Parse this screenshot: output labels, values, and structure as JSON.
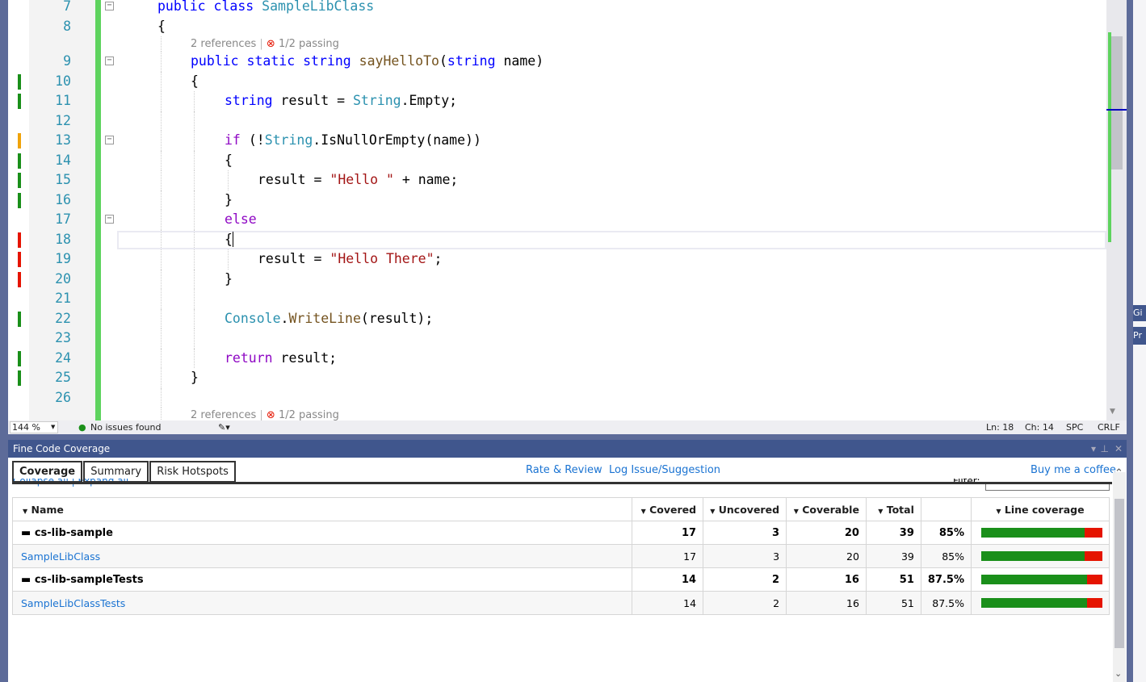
{
  "editor": {
    "colors": {
      "covered": "#1a8f1a",
      "partial": "#f0a30a",
      "uncovered": "#e51400"
    },
    "rows": [
      {
        "n": "7",
        "indent": 1,
        "fold": true,
        "tokens": [
          [
            "k",
            "public "
          ],
          [
            "k",
            "class "
          ],
          [
            "t",
            "SampleLibClass"
          ]
        ]
      },
      {
        "n": "8",
        "indent": 1,
        "tokens": [
          [
            "p",
            "{"
          ]
        ]
      },
      {
        "lens": true,
        "indent": 2,
        "refs": "2 references",
        "tests": "1/2 passing"
      },
      {
        "n": "9",
        "indent": 2,
        "fold": true,
        "tokens": [
          [
            "k",
            "public "
          ],
          [
            "k",
            "static "
          ],
          [
            "k",
            "string "
          ],
          [
            "m",
            "sayHelloTo"
          ],
          [
            "p",
            "("
          ],
          [
            "k",
            "string "
          ],
          [
            "p",
            "name)"
          ]
        ]
      },
      {
        "n": "10",
        "indent": 2,
        "cov": "covered",
        "tokens": [
          [
            "p",
            "{"
          ]
        ]
      },
      {
        "n": "11",
        "indent": 3,
        "cov": "covered",
        "tokens": [
          [
            "k",
            "string "
          ],
          [
            "p",
            "result = "
          ],
          [
            "t",
            "String"
          ],
          [
            "p",
            ".Empty;"
          ]
        ]
      },
      {
        "n": "12",
        "indent": 3,
        "tokens": []
      },
      {
        "n": "13",
        "indent": 3,
        "cov": "partial",
        "fold": true,
        "tokens": [
          [
            "c",
            "if "
          ],
          [
            "p",
            "(!"
          ],
          [
            "t",
            "String"
          ],
          [
            "p",
            ".IsNullOrEmpty(name))"
          ]
        ]
      },
      {
        "n": "14",
        "indent": 3,
        "cov": "covered",
        "tokens": [
          [
            "p",
            "{"
          ]
        ]
      },
      {
        "n": "15",
        "indent": 4,
        "cov": "covered",
        "tokens": [
          [
            "p",
            "result = "
          ],
          [
            "s",
            "\"Hello \""
          ],
          [
            "p",
            " + name;"
          ]
        ]
      },
      {
        "n": "16",
        "indent": 3,
        "cov": "covered",
        "tokens": [
          [
            "p",
            "}"
          ]
        ]
      },
      {
        "n": "17",
        "indent": 3,
        "fold": true,
        "tokens": [
          [
            "c",
            "else"
          ]
        ]
      },
      {
        "n": "18",
        "indent": 3,
        "cov": "uncovered",
        "current": true,
        "tokens": [
          [
            "p",
            "{"
          ]
        ]
      },
      {
        "n": "19",
        "indent": 4,
        "cov": "uncovered",
        "tokens": [
          [
            "p",
            "result = "
          ],
          [
            "s",
            "\"Hello There\""
          ],
          [
            "p",
            ";"
          ]
        ]
      },
      {
        "n": "20",
        "indent": 3,
        "cov": "uncovered",
        "tokens": [
          [
            "p",
            "}"
          ]
        ]
      },
      {
        "n": "21",
        "indent": 3,
        "tokens": []
      },
      {
        "n": "22",
        "indent": 3,
        "cov": "covered",
        "tokens": [
          [
            "t",
            "Console"
          ],
          [
            "p",
            "."
          ],
          [
            "m",
            "WriteLine"
          ],
          [
            "p",
            "(result);"
          ]
        ]
      },
      {
        "n": "23",
        "indent": 3,
        "tokens": []
      },
      {
        "n": "24",
        "indent": 3,
        "cov": "covered",
        "tokens": [
          [
            "c",
            "return "
          ],
          [
            "p",
            "result;"
          ]
        ]
      },
      {
        "n": "25",
        "indent": 2,
        "cov": "covered",
        "tokens": [
          [
            "p",
            "}"
          ]
        ]
      },
      {
        "n": "26",
        "indent": 2,
        "tokens": []
      },
      {
        "lens": true,
        "indent": 2,
        "refs": "2 references",
        "tests": "1/2 passing"
      }
    ]
  },
  "status": {
    "zoom": "144 %",
    "issues": "No issues found",
    "ln": "Ln: 18",
    "ch": "Ch: 14",
    "spc": "SPC",
    "crlf": "CRLF"
  },
  "side": {
    "tab1": "Gi",
    "tab2": "Pr"
  },
  "panel": {
    "title": "Fine Code Coverage",
    "tabs": [
      "Coverage",
      "Summary",
      "Risk Hotspots"
    ],
    "links": {
      "rate": "Rate & Review",
      "log": "Log Issue/Suggestion",
      "coffee": "Buy me a coffee"
    },
    "collapse": "Collapse all | Expand all",
    "filter": "Filter:",
    "columns": [
      "Name",
      "Covered",
      "Uncovered",
      "Coverable",
      "Total",
      "",
      "Line coverage"
    ],
    "rows": [
      {
        "type": "proj",
        "name": "cs-lib-sample",
        "covered": "17",
        "uncovered": "3",
        "coverable": "20",
        "total": "39",
        "pct": "85%",
        "pct_value": 85
      },
      {
        "type": "cls",
        "name": "SampleLibClass",
        "covered": "17",
        "uncovered": "3",
        "coverable": "20",
        "total": "39",
        "pct": "85%",
        "pct_value": 85
      },
      {
        "type": "proj",
        "name": "cs-lib-sampleTests",
        "covered": "14",
        "uncovered": "2",
        "coverable": "16",
        "total": "51",
        "pct": "87.5%",
        "pct_value": 87.5
      },
      {
        "type": "cls",
        "name": "SampleLibClassTests",
        "covered": "14",
        "uncovered": "2",
        "coverable": "16",
        "total": "51",
        "pct": "87.5%",
        "pct_value": 87.5
      }
    ]
  }
}
